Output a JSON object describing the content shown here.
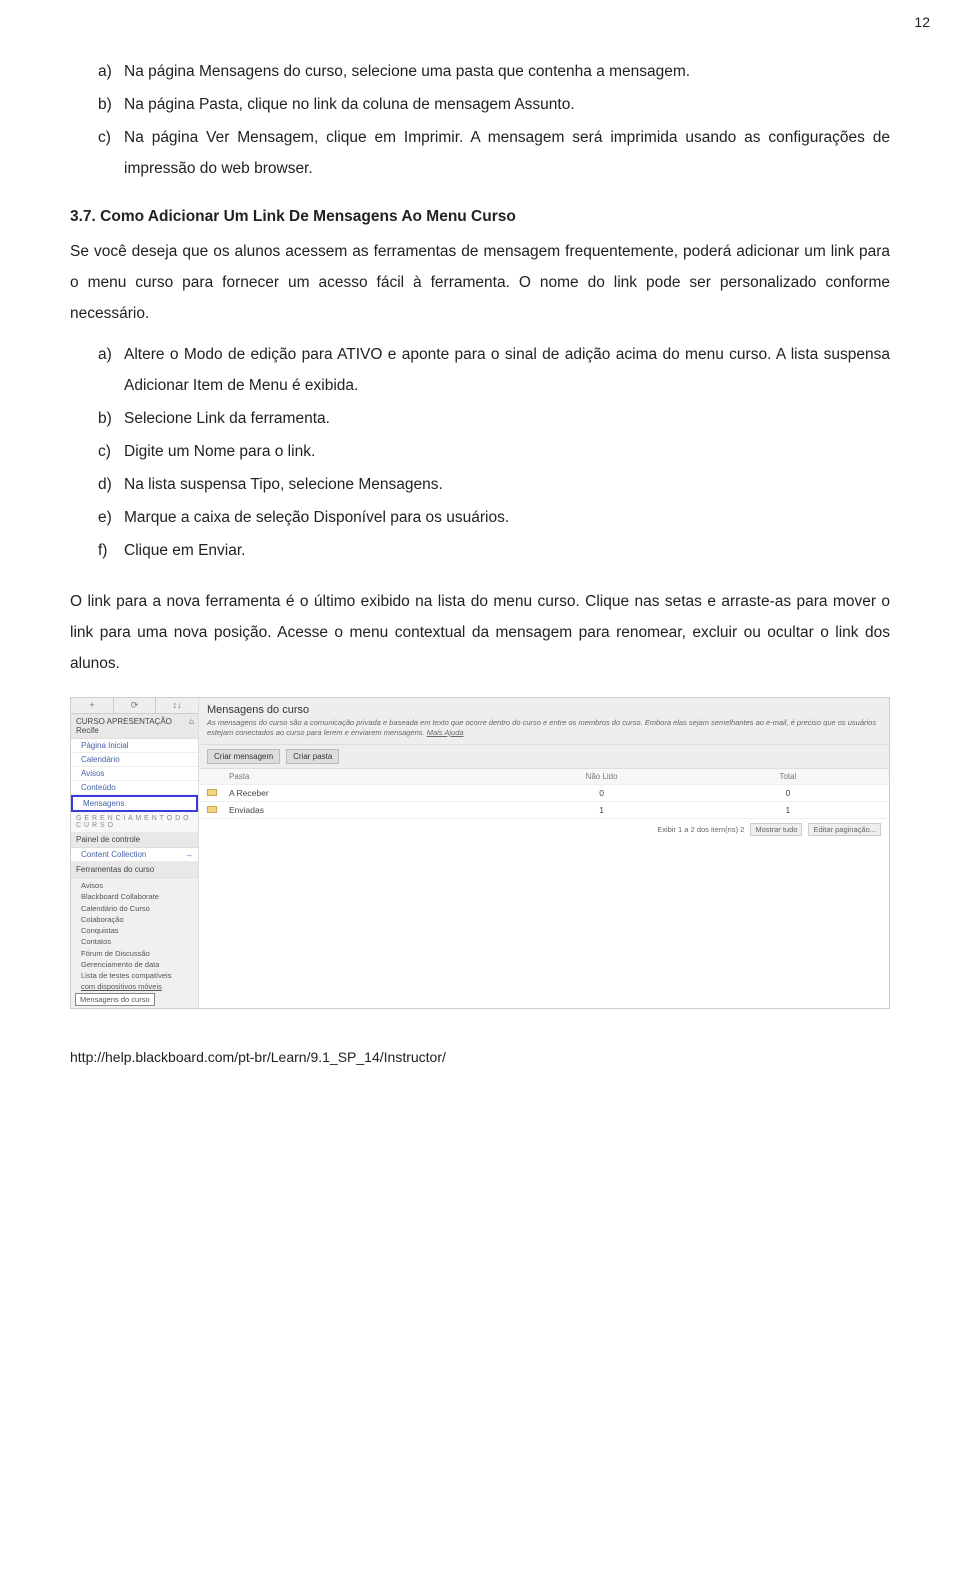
{
  "page_number": "12",
  "list1": {
    "a": "Na página Mensagens do curso, selecione uma pasta que contenha a mensagem.",
    "b": "Na página Pasta, clique no link da coluna de mensagem Assunto.",
    "c": "Na página Ver Mensagem, clique em Imprimir. A mensagem será imprimida usando as configurações de impressão do web browser."
  },
  "heading": "3.7. Como Adicionar Um Link De Mensagens Ao Menu Curso",
  "para1": "Se você deseja que os alunos acessem as ferramentas de mensagem frequentemente, poderá adicionar um link para o menu curso para fornecer um acesso fácil à ferramenta. O nome do link pode ser personalizado conforme necessário.",
  "list2": {
    "a": "Altere o Modo de edição para ATIVO e aponte para o sinal de adição acima do menu curso. A lista suspensa Adicionar Item de Menu é exibida.",
    "b": "Selecione Link da ferramenta.",
    "c": "Digite um Nome para o link.",
    "d": "Na lista suspensa Tipo, selecione Mensagens.",
    "e": "Marque a caixa de seleção Disponível para os usuários.",
    "f": "Clique em Enviar."
  },
  "para2": "O link para a nova ferramenta é o último exibido na lista do menu curso. Clique nas setas e arraste-as para mover o link para uma nova posição. Acesse o menu contextual da mensagem para renomear, excluir ou ocultar o link dos alunos.",
  "screenshot": {
    "toolbar_plus": "+",
    "toolbar_sep1": "⟳",
    "toolbar_sep2": "↕↓",
    "course_section": "CURSO APRESENTAÇÃO",
    "course_subtitle": "Recife",
    "nav": {
      "pagina_inicial": "Página Inicial",
      "calendario": "Calendário",
      "avisos": "Avisos",
      "conteudo": "Conteúdo",
      "mensagens": "Mensagens"
    },
    "gerenciamento": "G E R E N C I A M E N T O   D O   C U R S O",
    "painel": "Painel de controle",
    "content_collection": "Content Collection",
    "ferramentas_head": "Ferramentas do curso",
    "tools": [
      "Avisos",
      "Blackboard Collaborate",
      "Calendário do Curso",
      "Colaboração",
      "Conquistas",
      "Contatos",
      "Fórum de Discussão",
      "Gerenciamento de data",
      "Lista de testes compatíveis"
    ],
    "tools_more": "com dispositivos móveis",
    "tools_selected": "Mensagens do curso",
    "main_title": "Mensagens do curso",
    "main_desc": "As mensagens do curso são a comunicação privada e baseada em texto que ocorre dentro do curso e entre os membros do curso. Embora elas sejam semelhantes ao e-mail, é preciso que os usuários estejam conectados ao curso para lerem e enviarem mensagens.",
    "main_desc_link": "Mais Ajuda",
    "btn_criar_msg": "Criar mensagem",
    "btn_criar_pasta": "Criar pasta",
    "col_pasta": "Pasta",
    "col_nao_lido": "Não Lido",
    "col_total": "Total",
    "rows": [
      {
        "name": "A Receber",
        "unread": "0",
        "total": "0"
      },
      {
        "name": "Enviadas",
        "unread": "1",
        "total": "1"
      }
    ],
    "footer_pager": "Exibir 1 a 2 dos item(ns) 2",
    "footer_show_all": "Mostrar tudo",
    "footer_edit": "Editar paginação..."
  },
  "footer": "http://help.blackboard.com/pt-br/Learn/9.1_SP_14/Instructor/"
}
